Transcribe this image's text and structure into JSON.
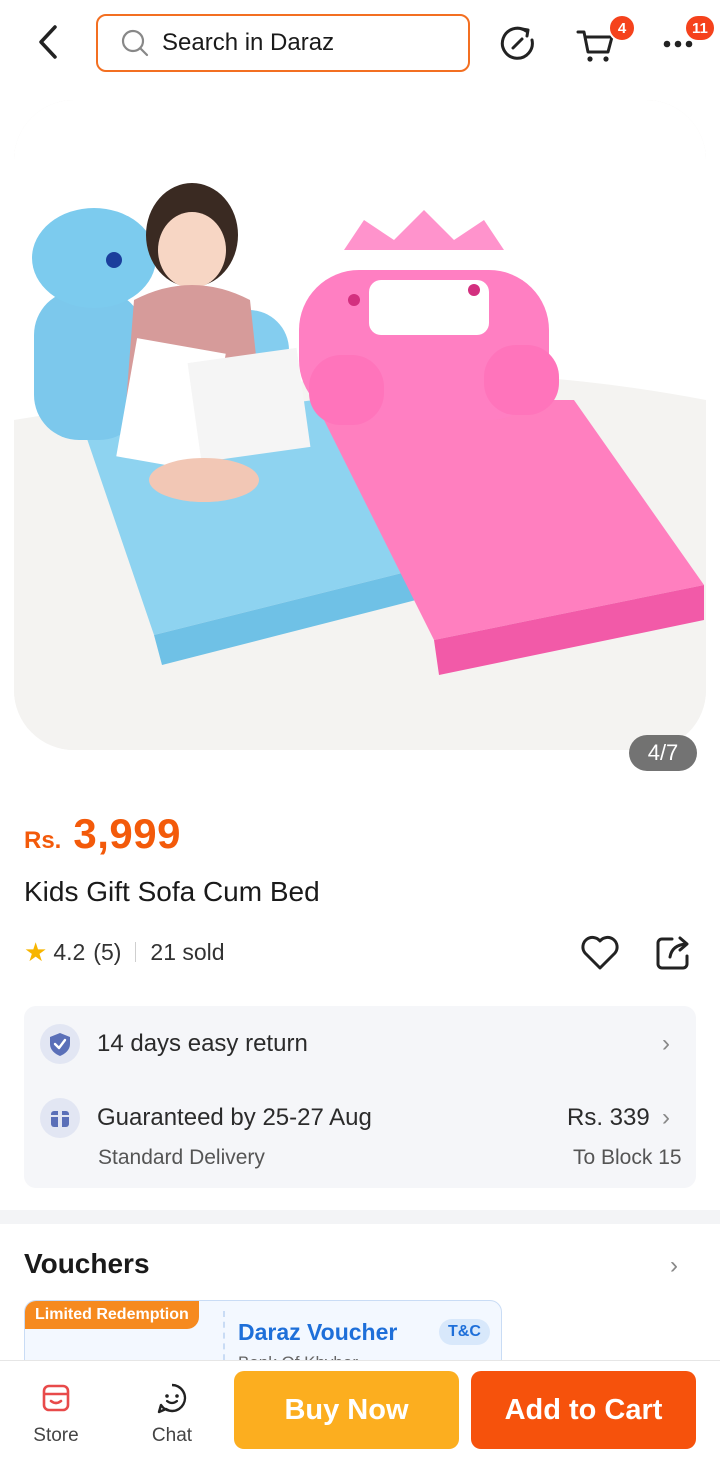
{
  "header": {
    "search_placeholder": "Search in Daraz",
    "cart_count": "4",
    "more_count": "11"
  },
  "gallery": {
    "counter": "4/7"
  },
  "product": {
    "currency": "Rs.",
    "price": "3,999",
    "title": "Kids Gift Sofa Cum Bed",
    "rating": "4.2",
    "reviews": "(5)",
    "sold": "21 sold"
  },
  "service": {
    "return_label": "14 days easy return",
    "delivery_label": "Guaranteed by 25-27 Aug",
    "delivery_type": "Standard Delivery",
    "delivery_fee": "Rs. 339",
    "delivery_to": "To Block 15"
  },
  "vouchers": {
    "title": "Vouchers",
    "limited_tag": "Limited Redemption",
    "voucher_name": "Daraz Voucher",
    "voucher_sub": "Bank Of Khyber",
    "tc_label": "T&C"
  },
  "bottom": {
    "store_label": "Store",
    "chat_label": "Chat",
    "buy_now_label": "Buy Now",
    "add_cart_label": "Add to Cart"
  },
  "colors": {
    "brand_orange": "#f36f21",
    "price_orange": "#f35a0a",
    "buy_now": "#fcae1f",
    "add_to_cart": "#f6520c"
  }
}
